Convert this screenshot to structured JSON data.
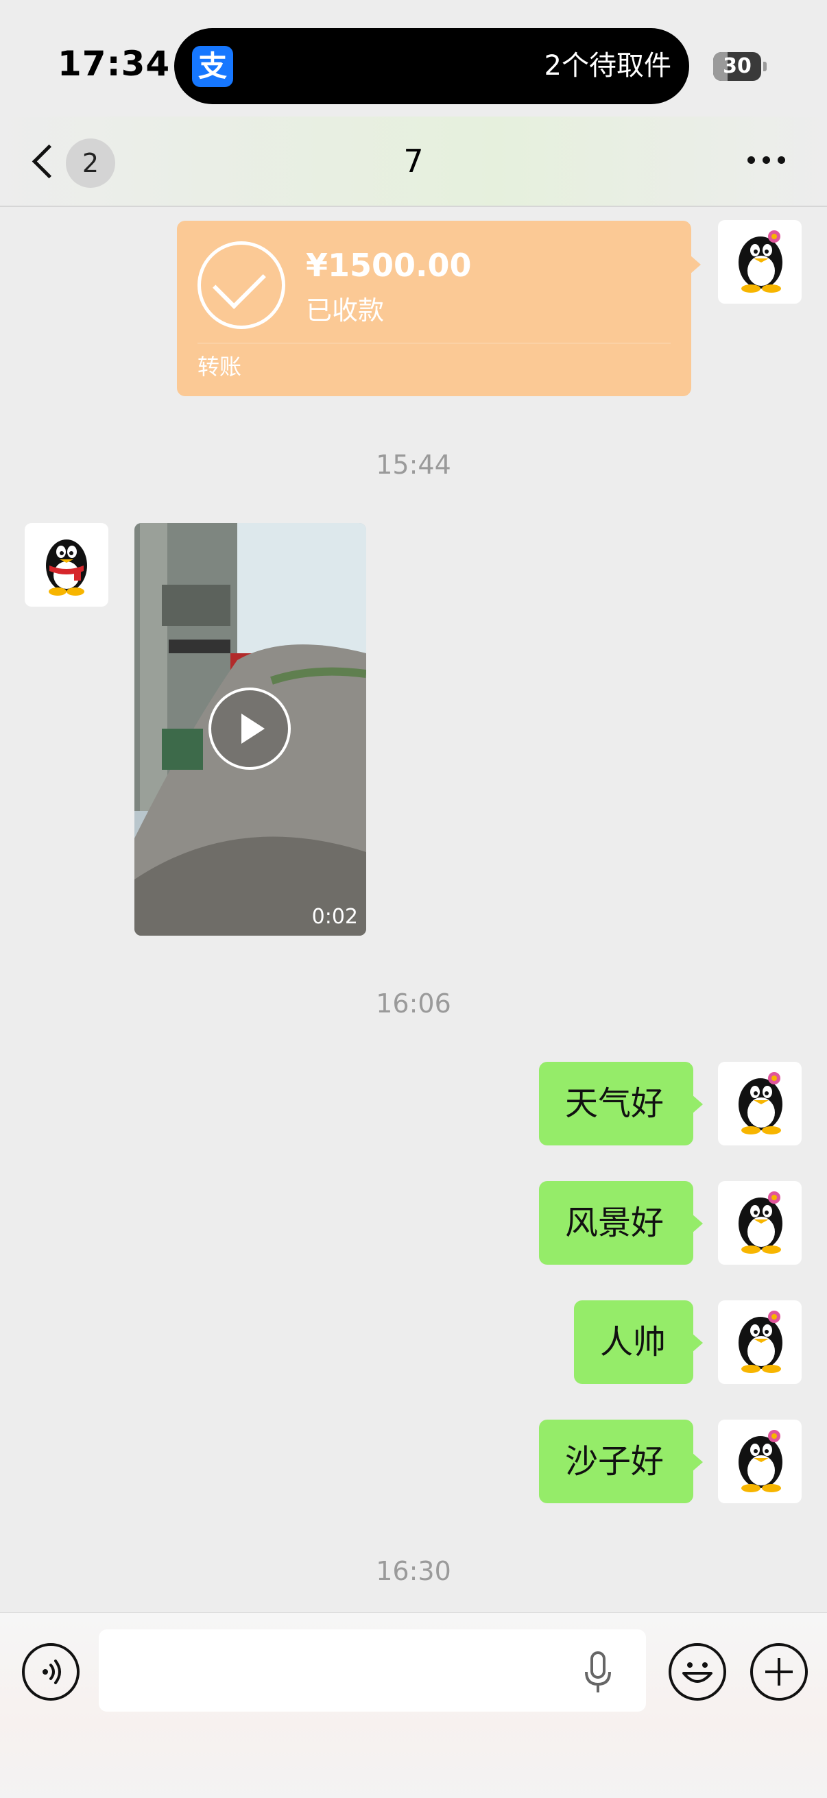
{
  "status_bar": {
    "time": "17:34",
    "island_app_icon": "支",
    "island_text": "2个待取件",
    "battery_level": "30",
    "battery_fraction": 0.3
  },
  "nav": {
    "back_icon": "chevron-left-icon",
    "unread_count": "2",
    "title": "7",
    "more_icon": "more-horizontal-icon"
  },
  "messages": {
    "transfer": {
      "amount": "¥1500.00",
      "status": "已收款",
      "label": "转账",
      "color": "#fbc995"
    },
    "timestamp_1": "15:44",
    "video": {
      "duration": "0:02"
    },
    "timestamp_2": "16:06",
    "texts": [
      "天气好",
      "风景好",
      "人帅",
      "沙子好"
    ],
    "bubble_color": "#95ec69",
    "timestamp_3": "16:30"
  },
  "input_bar": {
    "voice_icon": "voice-icon",
    "placeholder": "",
    "mic_icon": "microphone-icon",
    "emoji_icon": "emoji-icon",
    "plus_icon": "plus-icon"
  }
}
